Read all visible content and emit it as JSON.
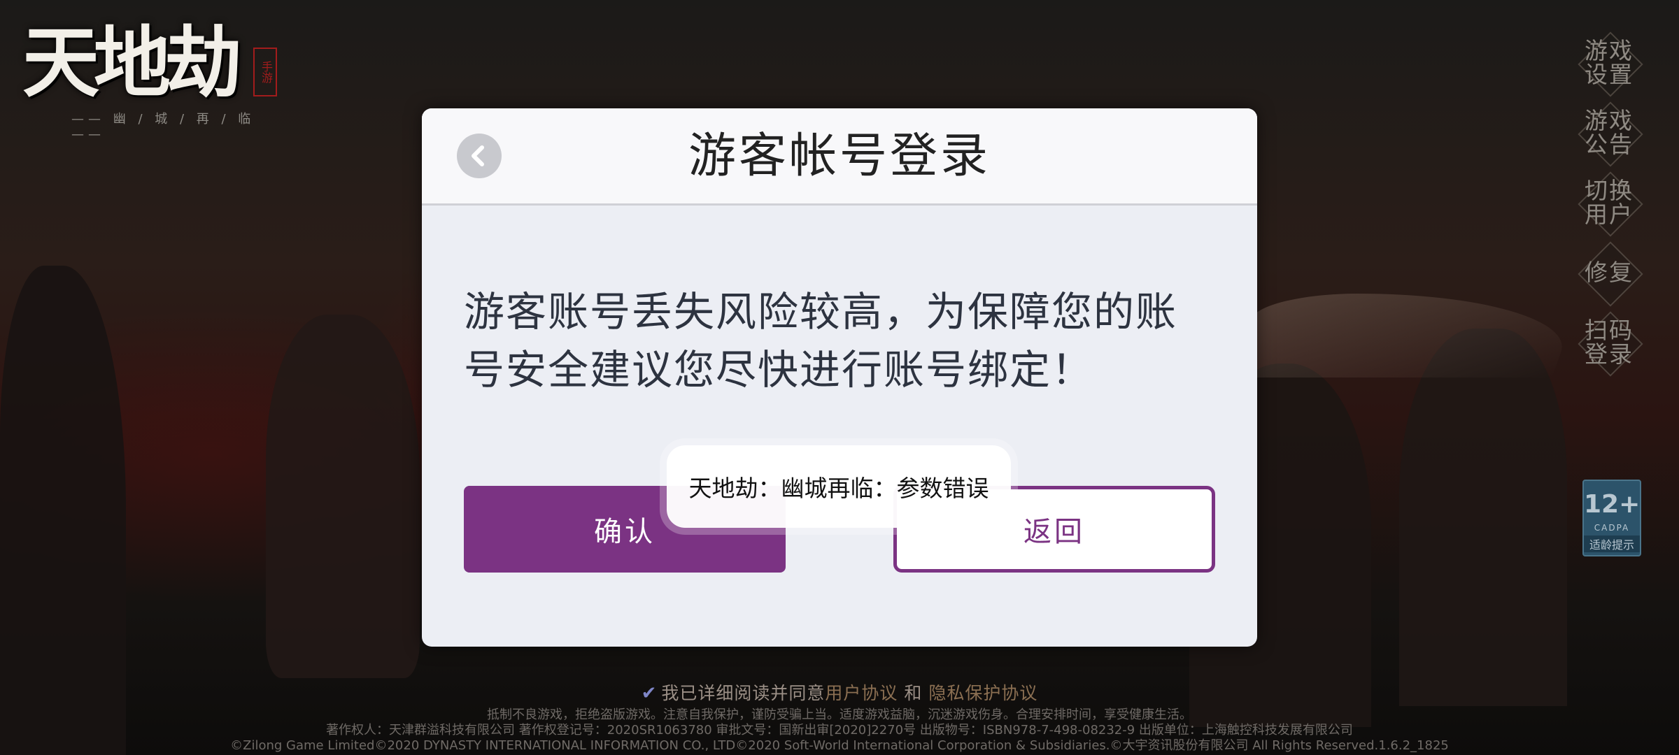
{
  "logo": {
    "title": "天地劫",
    "seal": "手游",
    "subtitle": "—— 幽 / 城 / 再 / 临 ——"
  },
  "side_menu": {
    "items": [
      {
        "label": "游戏设置"
      },
      {
        "label": "游戏公告"
      },
      {
        "label": "切换用户"
      },
      {
        "label": "修复"
      },
      {
        "label": "扫码登录"
      }
    ]
  },
  "age_badge": {
    "rating": "12+",
    "org": "CADPA",
    "tip": "适龄提示"
  },
  "dialog": {
    "title": "游客帐号登录",
    "message": "游客账号丢失风险较高，为保障您的账号安全建议您尽快进行账号绑定！",
    "confirm_label": "确认",
    "return_label": "返回"
  },
  "toast": {
    "text": "天地劫：幽城再临：参数错误"
  },
  "agreement": {
    "prefix": "我已详细阅读并同意",
    "user_agreement": "用户协议",
    "and": "和",
    "privacy_agreement": "隐私保护协议"
  },
  "footer": {
    "line1": "抵制不良游戏，拒绝盗版游戏。注意自我保护，谨防受骗上当。适度游戏益脑，沉迷游戏伤身。合理安排时间，享受健康生活。",
    "line2": "著作权人：天津群溢科技有限公司 著作权登记号：2020SR1063780 审批文号：国新出审[2020]2270号 出版物号：ISBN978-7-498-08232-9  出版单位：上海触控科技发展有限公司",
    "line3": "©Zilong Game Limited©2020 DYNASTY INTERNATIONAL INFORMATION CO., LTD©2020 Soft-World International Corporation & Subsidiaries.©大宇资讯股份有限公司 All Rights Reserved.1.6.2_1825"
  },
  "colors": {
    "accent": "#7b3383",
    "dialog_bg": "#eceef4",
    "header_bg": "#f8f8fa"
  }
}
